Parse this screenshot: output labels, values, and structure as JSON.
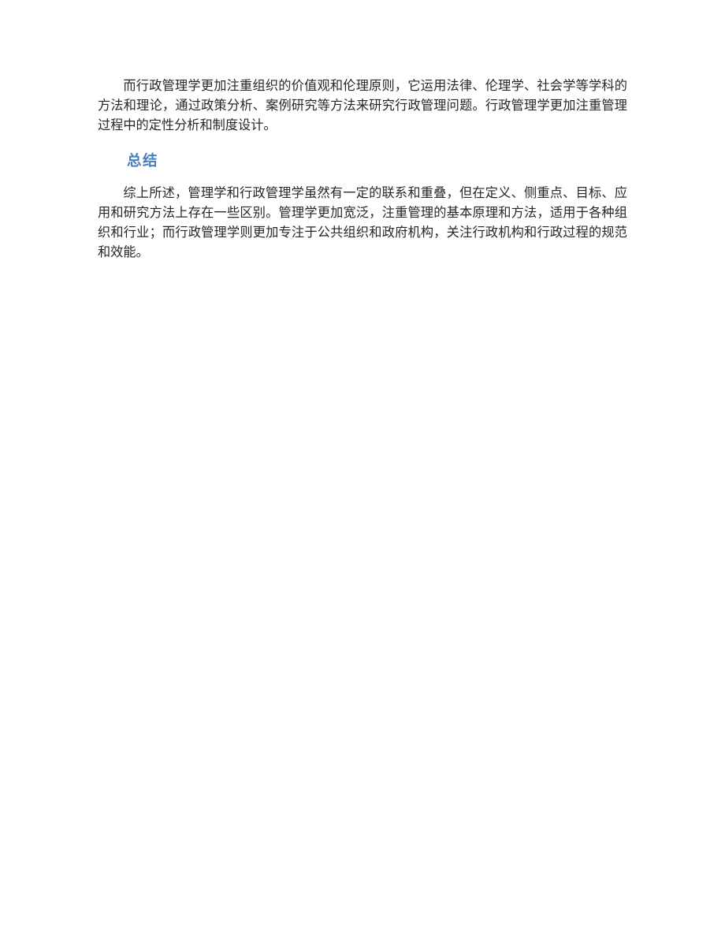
{
  "document": {
    "page_background": "#ffffff",
    "body_text_color": "#262626",
    "heading_color": "#4a7ebb",
    "blocks": [
      {
        "type": "paragraph",
        "name": "paragraph-public-administration-values",
        "text": "而行政管理学更加注重组织的价值观和伦理原则，它运用法律、伦理学、社会学等学科的方法和理论，通过政策分析、案例研究等方法来研究行政管理问题。行政管理学更加注重管理过程中的定性分析和制度设计。"
      },
      {
        "type": "heading",
        "name": "heading-summary",
        "text": "总结"
      },
      {
        "type": "paragraph",
        "name": "paragraph-summary-body",
        "text": "综上所述，管理学和行政管理学虽然有一定的联系和重叠，但在定义、侧重点、目标、应用和研究方法上存在一些区别。管理学更加宽泛，注重管理的基本原理和方法，适用于各种组织和行业；而行政管理学则更加专注于公共组织和政府机构，关注行政机构和行政过程的规范和效能。"
      }
    ]
  }
}
